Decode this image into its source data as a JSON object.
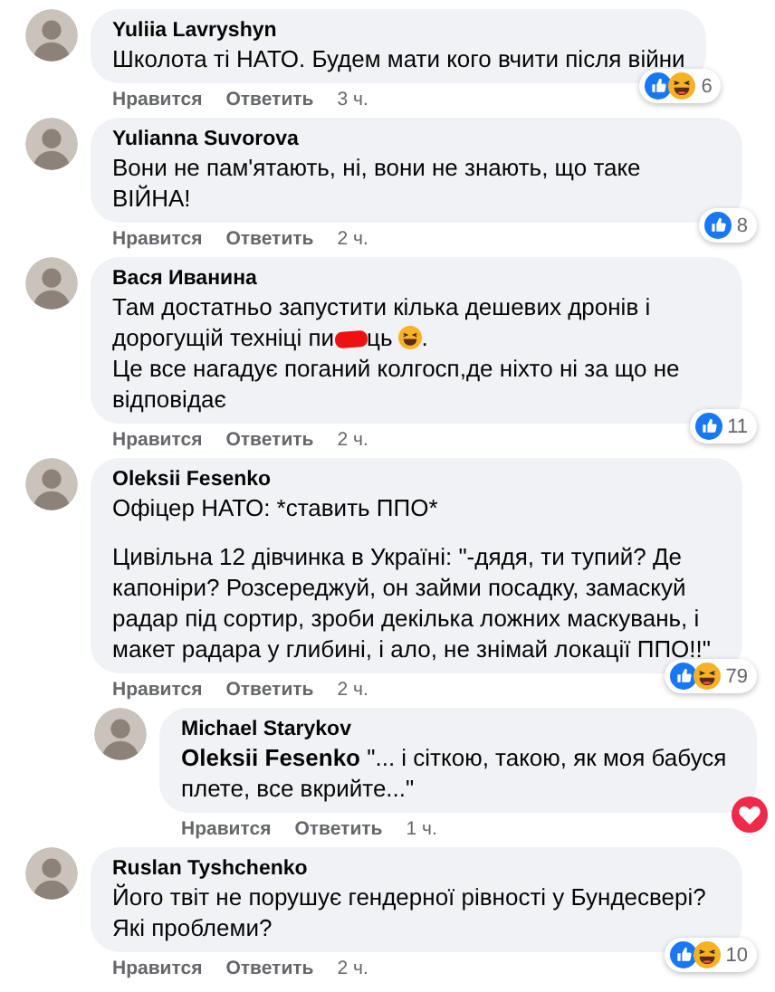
{
  "comments": [
    {
      "name": "Yuliia Lavryshyn",
      "body": [
        [
          {
            "kind": "text",
            "text": "Школота ті НАТО. Будем мати кого вчити після війни"
          }
        ]
      ],
      "reactions": {
        "items": [
          {
            "kind": "like"
          },
          {
            "kind": "haha"
          }
        ],
        "count": "6"
      },
      "actions": [
        "Нравится",
        "Ответить"
      ],
      "time": "3 ч."
    },
    {
      "name": "Yulianna Suvorova",
      "body": [
        [
          {
            "kind": "text",
            "text": "Вони не пам'ятають, ні, вони не знають, що таке ВІЙНА!"
          }
        ]
      ],
      "reactions": {
        "items": [
          {
            "kind": "like"
          }
        ],
        "count": "8"
      },
      "actions": [
        "Нравится",
        "Ответить"
      ],
      "time": "2 ч."
    },
    {
      "name": "Вася Иванина",
      "body": [
        [
          {
            "kind": "text",
            "text": "Там достатньо запустити кілька дешевих дронів і"
          }
        ],
        [
          {
            "kind": "text",
            "text": "дорогущій техніці пи"
          },
          {
            "kind": "censor"
          },
          {
            "kind": "text",
            "text": "ць"
          },
          {
            "kind": "emoji"
          },
          {
            "kind": "text",
            "text": "."
          }
        ],
        [
          {
            "kind": "text",
            "text": "Це все нагадує поганий колгосп,де ніхто ні за що не відповідає"
          }
        ]
      ],
      "reactions": {
        "items": [
          {
            "kind": "like"
          }
        ],
        "count": "11"
      },
      "actions": [
        "Нравится",
        "Ответить"
      ],
      "time": "2 ч."
    },
    {
      "name": "Oleksii Fesenko",
      "para_gap": true,
      "body": [
        [
          {
            "kind": "text",
            "text": "Офіцер НАТО: *ставить ППО*"
          }
        ],
        [
          {
            "kind": "text",
            "text": "Цивільна 12 дівчинка в Україні: \"-дядя, ти тупий? Де капоніри? Розсереджуй, он займи посадку, замаскуй радар під сортир, зроби декілька ложних маскувань, і макет радара у глибині, і ало, не знімай локації ППО!!\""
          }
        ]
      ],
      "reactions": {
        "items": [
          {
            "kind": "like"
          },
          {
            "kind": "haha"
          }
        ],
        "count": "79"
      },
      "actions": [
        "Нравится",
        "Ответить"
      ],
      "time": "2 ч.",
      "replies": [
        {
          "name": "Michael Starykov",
          "body": [
            [
              {
                "kind": "rich",
                "text": "**Oleksii Fesenko** \"... і сіткою, такою, як моя бабуся плете, все вкрийте...\""
              }
            ]
          ],
          "reactions": {
            "items": [
              {
                "kind": "love"
              }
            ]
          },
          "actions": [
            "Нравится",
            "Ответить"
          ],
          "time": "1 ч."
        }
      ]
    },
    {
      "name": "Ruslan Tyshchenko",
      "body": [
        [
          {
            "kind": "text",
            "text": "Його твіт не порушує гендерної рівності у Бундесвері? Які проблеми?"
          }
        ]
      ],
      "reactions": {
        "items": [
          {
            "kind": "like"
          },
          {
            "kind": "haha"
          }
        ],
        "count": "10"
      },
      "actions": [
        "Нравится",
        "Ответить"
      ],
      "time": "2 ч."
    }
  ]
}
